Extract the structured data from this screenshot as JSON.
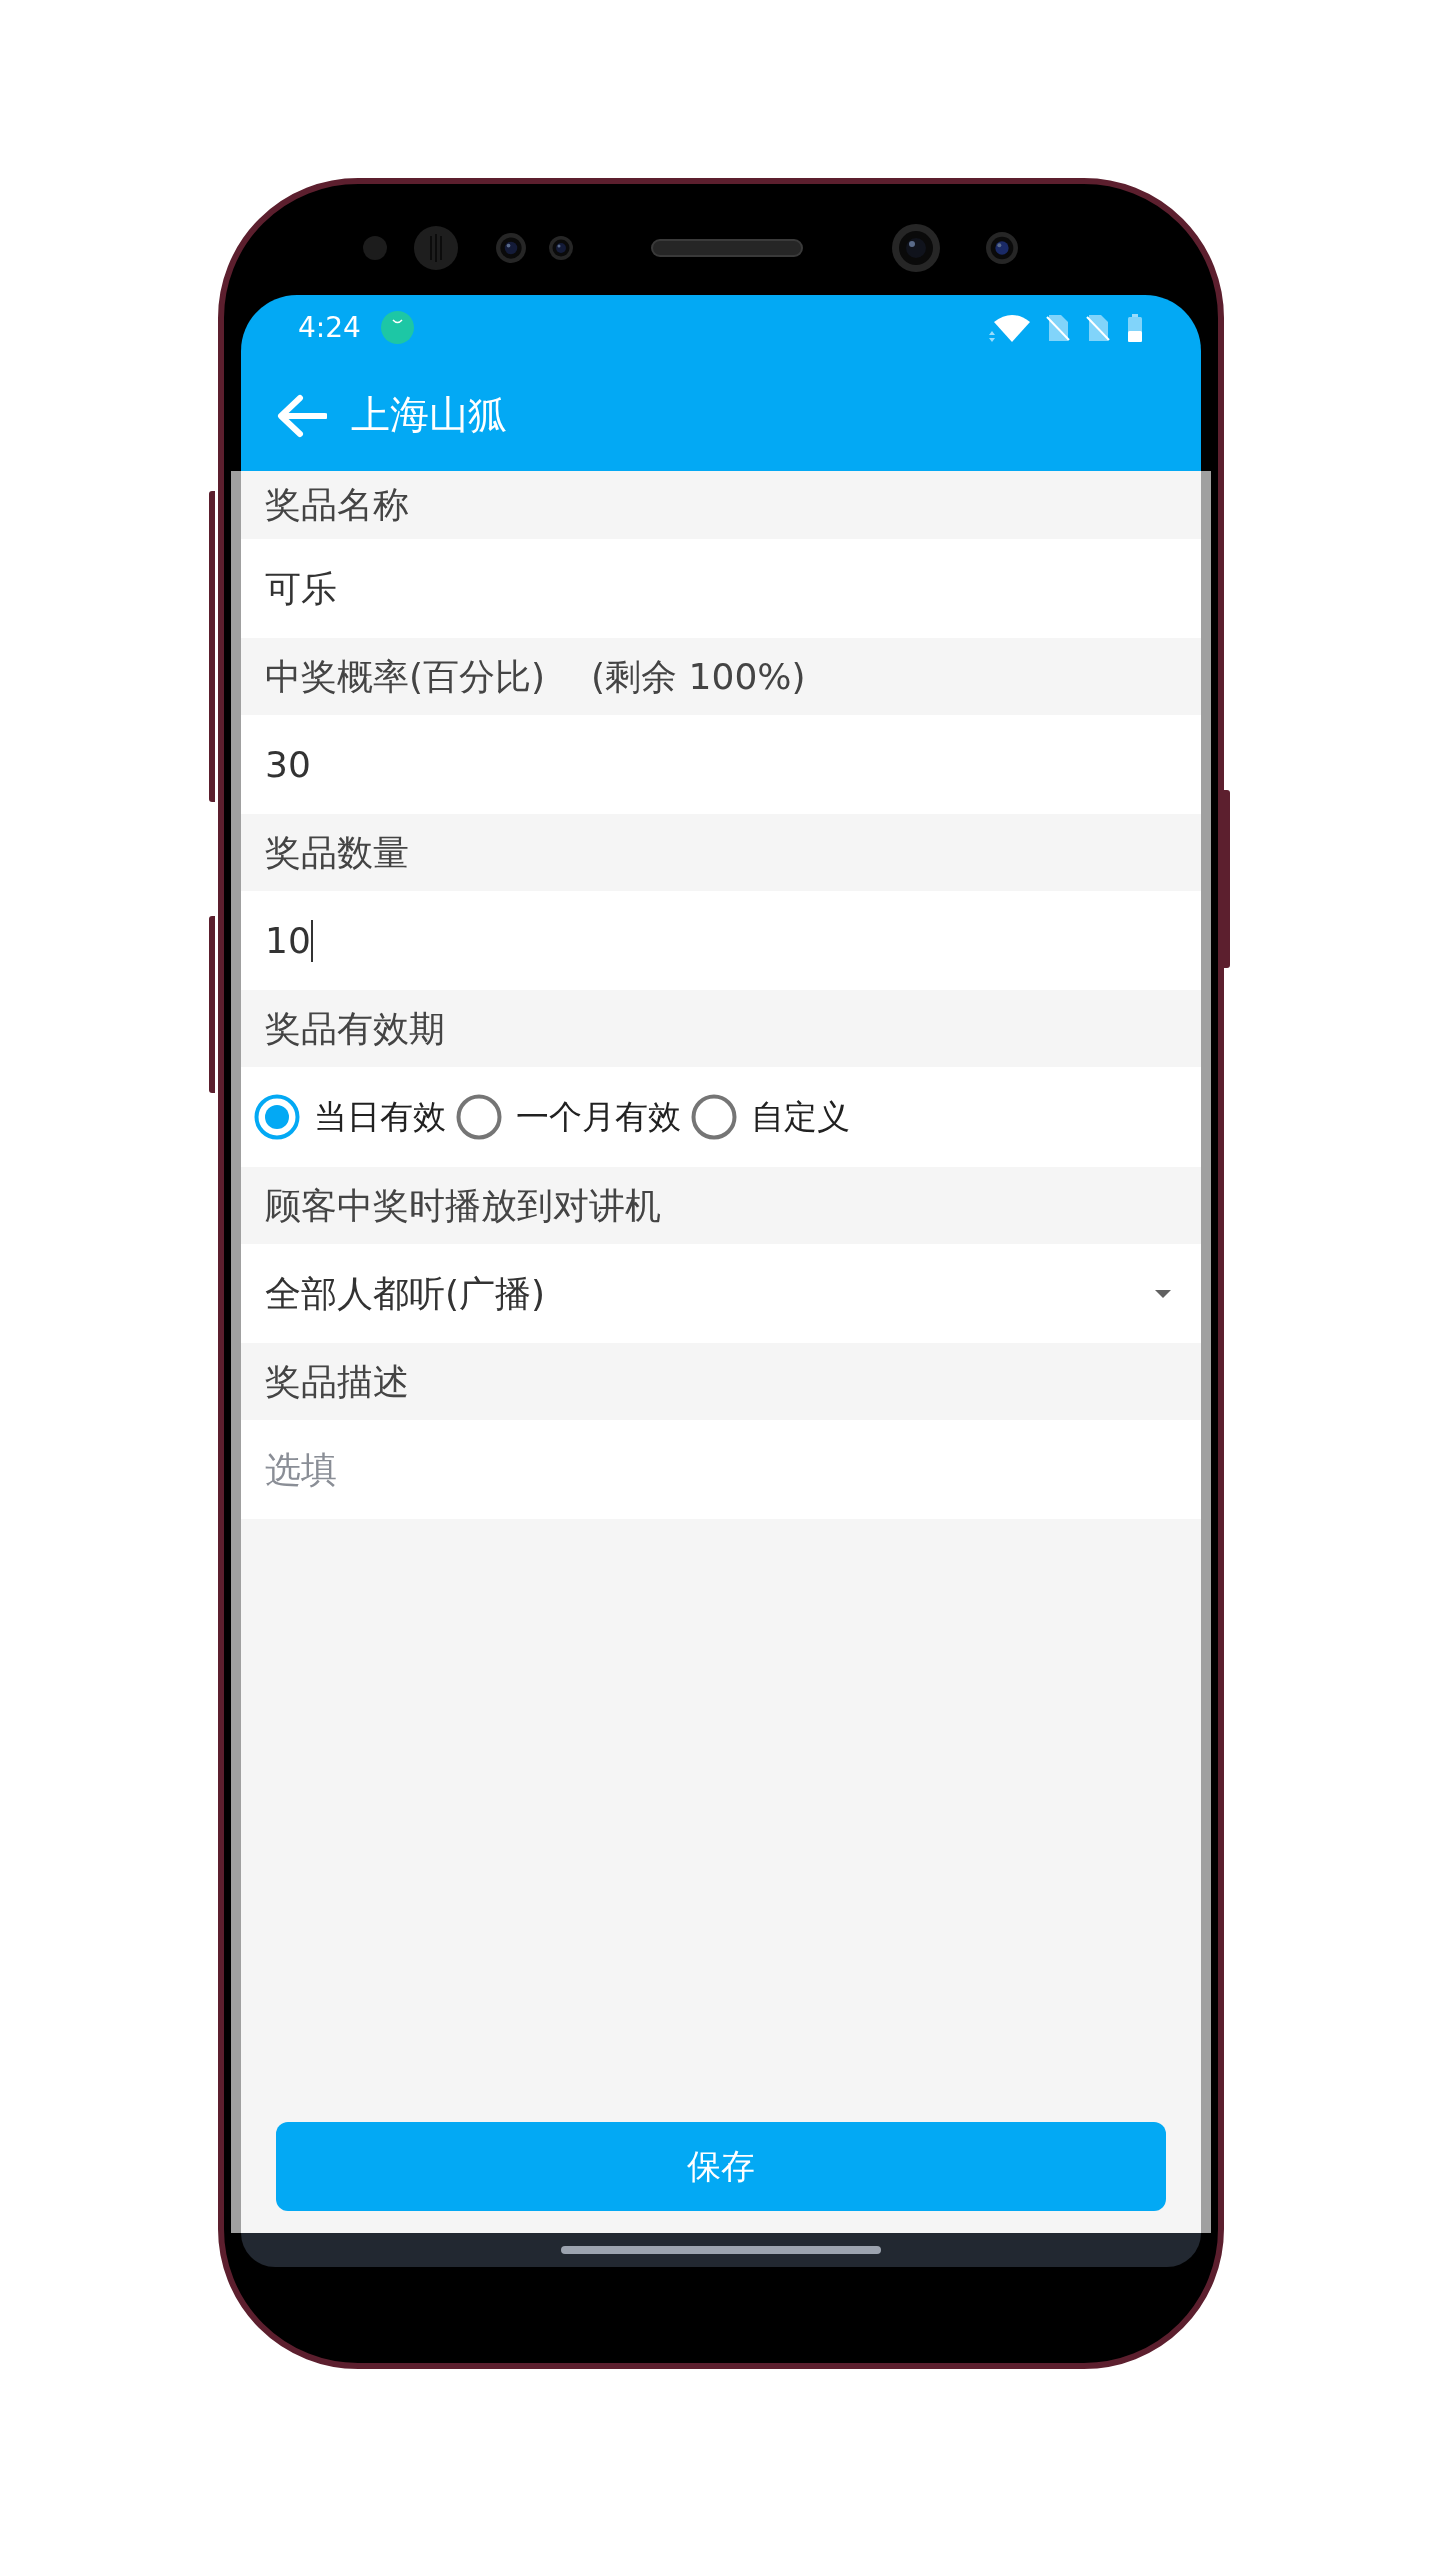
{
  "status_bar": {
    "time": "4:24"
  },
  "toolbar": {
    "title": "上海山狐"
  },
  "form": {
    "fields": [
      {
        "kind": "text",
        "label": "奖品名称",
        "value": "可乐",
        "focused": false
      },
      {
        "kind": "text",
        "label": "中奖概率(百分比)",
        "note": "(剩余 100%)",
        "value": "30",
        "focused": false
      },
      {
        "kind": "text",
        "label": "奖品数量",
        "value": "10",
        "focused": true
      },
      {
        "kind": "radio",
        "label": "奖品有效期",
        "options": [
          {
            "label": "当日有效",
            "selected": true
          },
          {
            "label": "一个月有效",
            "selected": false
          },
          {
            "label": "自定义",
            "selected": false
          }
        ]
      },
      {
        "kind": "select",
        "label": "顾客中奖时播放到对讲机",
        "value": "全部人都听(广播)"
      },
      {
        "kind": "text",
        "label": "奖品描述",
        "placeholder": "选填",
        "focused": false
      }
    ]
  },
  "save_button": {
    "label": "保存"
  }
}
